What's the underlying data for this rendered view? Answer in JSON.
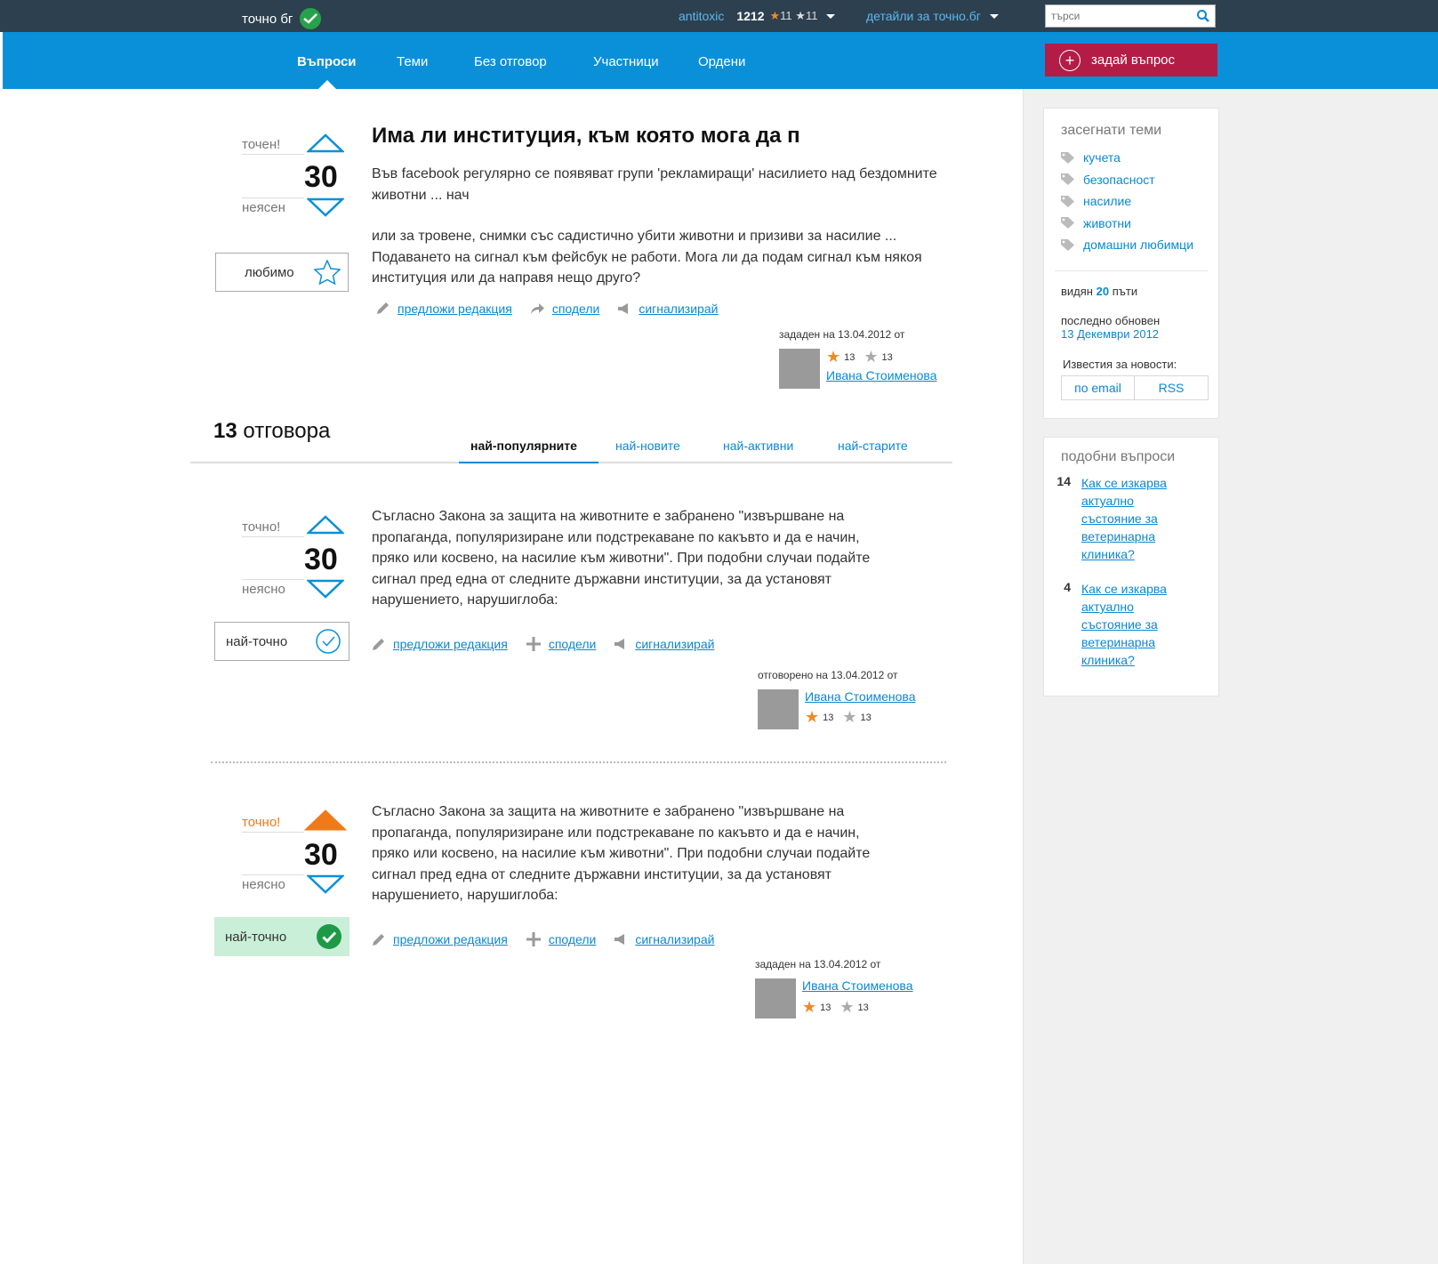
{
  "topbar": {
    "logo": "точно бг",
    "user": "antitoxic",
    "points": "1212",
    "stars_gold": "11",
    "stars_silver": "11",
    "details": "детайли за точно.бг",
    "search_placeholder": "търси"
  },
  "nav": {
    "items": [
      "Въпроси",
      "Теми",
      "Без отговор",
      "Участници",
      "Ордени"
    ],
    "ask_button": "задай въпрос"
  },
  "question": {
    "vote_up_label": "точен!",
    "vote_down_label": "неясен",
    "votes": "30",
    "favorite_label": "любимо",
    "title": "Има ли институция, към която мога да п",
    "body_1": "Във facebook регулярно се появяват групи 'рекламиращи' насилието над бездомните животни ... нач",
    "body_2": "или за тровене, снимки със садистично убити животни и призиви за насилие ... Подаването на сигнал към фейсбук не работи. Мога ли да подам сигнал към някоя институция или да направя нещо друго?",
    "actions": [
      "предложи редакция",
      "сподели",
      "сигнализирай"
    ],
    "author_caption": "зададен на 13.04.2012 от",
    "author_name": "Ивана Стоименова",
    "author_gold": "13",
    "author_silver": "13"
  },
  "answers_header": {
    "count": "13",
    "label": "отговора",
    "tabs": [
      "най-популярните",
      "най-новите",
      "най-активни",
      "най-старите"
    ]
  },
  "answers": [
    {
      "vote_up_label": "точно!",
      "vote_down_label": "неясно",
      "votes": "30",
      "accept_label": "най-точно",
      "body": "Съгласно Закона за защита на животните е забранено \"извършване на пропаганда, популяризиране или подстрекаване по какъвто и да е начин, пряко или косвено, на насилие към животни\". При подобни случаи подайте сигнал пред една от следните държавни институции, за да установят нарушението, нарушиглоба:",
      "actions": [
        "предложи редакция",
        "сподели",
        "сигнализирай"
      ],
      "author_caption": "отговорено на 13.04.2012 от",
      "author_name": "Ивана Стоименова",
      "author_gold": "13",
      "author_silver": "13",
      "voted_up": false,
      "accepted": false
    },
    {
      "vote_up_label": "точно!",
      "vote_down_label": "неясно",
      "votes": "30",
      "accept_label": "най-точно",
      "body": "Съгласно Закона за защита на животните е забранено \"извършване на пропаганда, популяризиране или подстрекаване по какъвто и да е начин, пряко или косвено, на насилие към животни\". При подобни случаи подайте сигнал пред една от следните държавни институции, за да установят нарушението, нарушиглоба:",
      "actions": [
        "предложи редакция",
        "сподели",
        "сигнализирай"
      ],
      "author_caption": "зададен на 13.04.2012 от",
      "author_name": "Ивана Стоименова",
      "author_gold": "13",
      "author_silver": "13",
      "voted_up": true,
      "accepted": true
    }
  ],
  "sidebar": {
    "topics_title": "засегнати теми",
    "topics": [
      "кучета",
      "безопасност",
      "насилие",
      "животни",
      "домашни любимци"
    ],
    "seen_prefix": "видян",
    "seen_count": "20",
    "seen_suffix": "пъти",
    "updated_label": "последно обновен",
    "updated_date": "13 Декември 2012",
    "notify_label": "Известия за новости:",
    "notify_email": "по email",
    "notify_rss": "RSS",
    "similar_title": "подобни въпроси",
    "similar": [
      {
        "count": "14",
        "title": "Как се изкарва  актуално състояние за ветеринарна клиника?"
      },
      {
        "count": "4",
        "title": "Как се изкарва  актуално състояние за ветеринарна клиника?"
      }
    ]
  },
  "colors": {
    "topbar": "#2d4050",
    "nav": "#0a90d8",
    "ask_button": "#b31d45",
    "link": "#0a88d2",
    "vote_active": "#f07a1a",
    "accepted_bg": "#c9efd8",
    "accepted_check": "#1e9a46"
  }
}
